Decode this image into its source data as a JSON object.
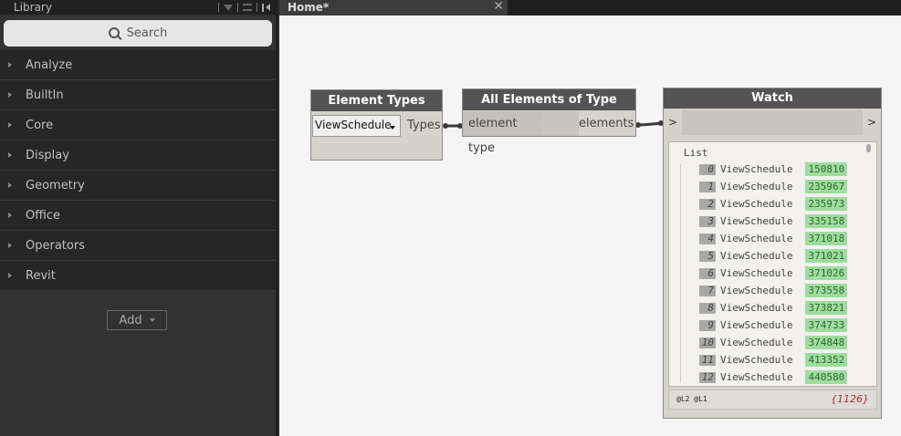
{
  "library": {
    "title": "Library",
    "search_placeholder": "Search",
    "categories": [
      "Analyze",
      "BuiltIn",
      "Core",
      "Display",
      "Geometry",
      "Office",
      "Operators",
      "Revit"
    ],
    "add_label": "Add"
  },
  "tabs": [
    {
      "label": "Home*",
      "close": "✕"
    }
  ],
  "nodes": {
    "element_types": {
      "title": "Element Types",
      "selected": "ViewSchedule",
      "output": "Types"
    },
    "all_elements": {
      "title": "All Elements of Type",
      "input": "element type",
      "output": "elements"
    },
    "watch": {
      "title": "Watch",
      "input_port": ">",
      "output_port": ">",
      "list_label": "List",
      "items": [
        {
          "index": "0",
          "type": "ViewSchedule",
          "id": "150810"
        },
        {
          "index": "1",
          "type": "ViewSchedule",
          "id": "235967"
        },
        {
          "index": "2",
          "type": "ViewSchedule",
          "id": "235973"
        },
        {
          "index": "3",
          "type": "ViewSchedule",
          "id": "335158"
        },
        {
          "index": "4",
          "type": "ViewSchedule",
          "id": "371018"
        },
        {
          "index": "5",
          "type": "ViewSchedule",
          "id": "371021"
        },
        {
          "index": "6",
          "type": "ViewSchedule",
          "id": "371026"
        },
        {
          "index": "7",
          "type": "ViewSchedule",
          "id": "373558"
        },
        {
          "index": "8",
          "type": "ViewSchedule",
          "id": "373821"
        },
        {
          "index": "9",
          "type": "ViewSchedule",
          "id": "374733"
        },
        {
          "index": "10",
          "type": "ViewSchedule",
          "id": "374848"
        },
        {
          "index": "11",
          "type": "ViewSchedule",
          "id": "413352"
        },
        {
          "index": "12",
          "type": "ViewSchedule",
          "id": "440580"
        }
      ],
      "levels": "@L2 @L1",
      "count": "{1126}"
    }
  },
  "colors": {
    "node_header": "#545454",
    "node_body": "#d5d2cc",
    "canvas": "#f5f5f5",
    "id_highlight": "#9fdc9f"
  }
}
